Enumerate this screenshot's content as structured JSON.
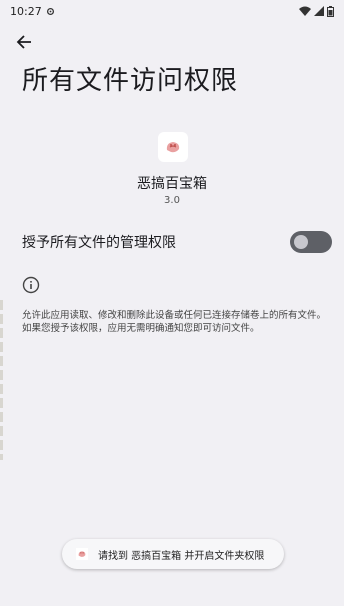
{
  "status_bar": {
    "time": "10:27",
    "icons": [
      "settings-gear-icon",
      "wifi-icon",
      "signal-icon",
      "battery-icon"
    ]
  },
  "header": {
    "back_icon": "arrow-left-icon",
    "title": "所有文件访问权限"
  },
  "app": {
    "icon": "app-logo-icon",
    "name": "恶搞百宝箱",
    "version": "3.0"
  },
  "permission": {
    "label": "授予所有文件的管理权限",
    "enabled": false
  },
  "info": {
    "icon": "info-icon",
    "description": "允许此应用读取、修改和删除此设备或任何已连接存储卷上的所有文件。如果您授予该权限，应用无需明确通知您即可访问文件。"
  },
  "toast": {
    "icon": "app-logo-icon",
    "text": "请找到 恶搞百宝箱 并开启文件夹权限"
  },
  "colors": {
    "background": "#f1f0f4",
    "toggle_track": "#5e6066",
    "toggle_knob": "#c7c7cd"
  }
}
